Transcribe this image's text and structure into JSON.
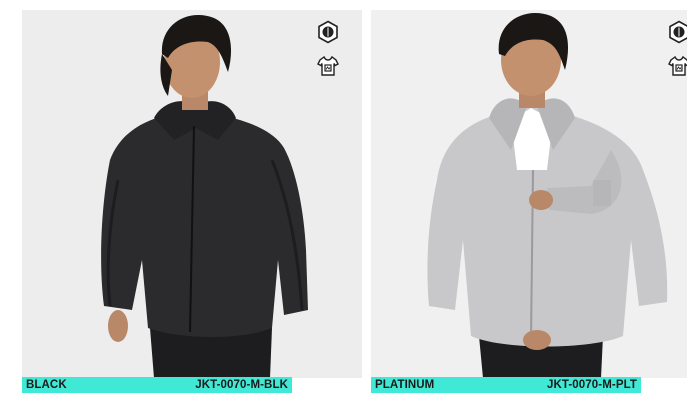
{
  "products": [
    {
      "color_name": "BLACK",
      "sku": "JKT-0070-M-BLK",
      "jacket_color": "#2b2b2d",
      "background_color": "#ededed"
    },
    {
      "color_name": "PLATINUM",
      "sku": "JKT-0070-M-PLT",
      "jacket_color": "#c8c8ca",
      "background_color": "#f0f0f0"
    }
  ],
  "caption_bar_color": "#3fe9d6",
  "icons": {
    "badge_top": "shield-leaf-icon",
    "badge_bottom": "tshirt-tag-icon"
  }
}
